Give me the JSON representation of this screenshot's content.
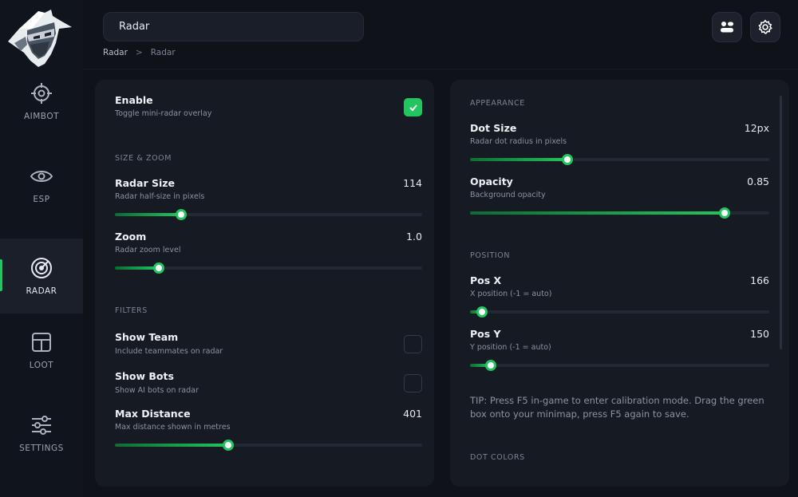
{
  "colors": {
    "accent": "#22c55e",
    "background": "#0f1219",
    "panel": "#161a23"
  },
  "sidebar": {
    "items": [
      {
        "label": "AIMBOT",
        "icon": "crosshair-icon",
        "active": false
      },
      {
        "label": "ESP",
        "icon": "eye-icon",
        "active": false
      },
      {
        "label": "RADAR",
        "icon": "radar-icon",
        "active": true
      },
      {
        "label": "LOOT",
        "icon": "layout-icon",
        "active": false
      },
      {
        "label": "SETTINGS",
        "icon": "sliders-icon",
        "active": false
      }
    ]
  },
  "header": {
    "search_value": "Radar",
    "breadcrumb": {
      "root": "Radar",
      "separator": ">",
      "current": "Radar"
    },
    "buttons": [
      {
        "icon": "users-icon"
      },
      {
        "icon": "gear-icon"
      }
    ]
  },
  "left_panel": {
    "enable": {
      "title": "Enable",
      "desc": "Toggle mini-radar overlay",
      "checked": true
    },
    "size_zoom_title": "SIZE & ZOOM",
    "radar_size": {
      "title": "Radar Size",
      "desc": "Radar half-size in pixels",
      "value": "114",
      "fraction": 0.215
    },
    "zoom": {
      "title": "Zoom",
      "desc": "Radar zoom level",
      "value": "1.0",
      "fraction": 0.143
    },
    "filters_title": "FILTERS",
    "show_team": {
      "title": "Show Team",
      "desc": "Include teammates on radar",
      "checked": false
    },
    "show_bots": {
      "title": "Show Bots",
      "desc": "Show AI bots on radar",
      "checked": false
    },
    "max_distance": {
      "title": "Max Distance",
      "desc": "Max distance shown in metres",
      "value": "401",
      "fraction": 0.37
    }
  },
  "right_panel": {
    "appearance_title": "APPEARANCE",
    "dot_size": {
      "title": "Dot Size",
      "desc": "Radar dot radius in pixels",
      "value": "12px",
      "fraction": 0.325
    },
    "opacity": {
      "title": "Opacity",
      "desc": "Background opacity",
      "value": "0.85",
      "fraction": 0.85
    },
    "position_title": "POSITION",
    "pos_x": {
      "title": "Pos X",
      "desc": "X position (-1 = auto)",
      "value": "166",
      "fraction": 0.04
    },
    "pos_y": {
      "title": "Pos Y",
      "desc": "Y position (-1 = auto)",
      "value": "150",
      "fraction": 0.068
    },
    "tip": "TIP: Press F5 in-game to enter calibration mode. Drag the green box onto your minimap, press F5 again to save.",
    "dot_colors_title": "DOT COLORS"
  }
}
